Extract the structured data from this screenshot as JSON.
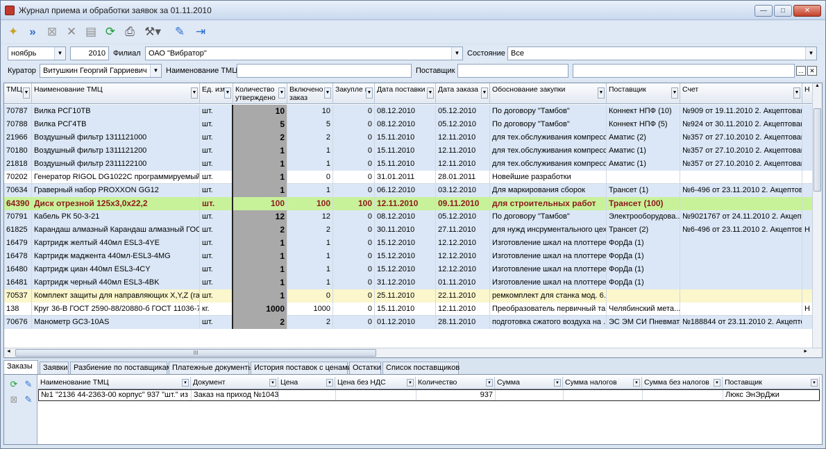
{
  "window": {
    "title": "Журнал приема и обработки заявок за 01.11.2010",
    "buttons": [
      "—",
      "□",
      "✕"
    ]
  },
  "toolbar": {
    "icons": [
      "wand-icon",
      "forward-icon",
      "cancel-box-icon",
      "delete-icon",
      "save-icon",
      "refresh-icon",
      "print-icon",
      "tools-icon",
      "edit-icon",
      "exit-icon"
    ]
  },
  "filters": {
    "month": "ноябрь",
    "year": "2010",
    "branch_label": "Филиал",
    "branch": "ОАО \"Вибратор\"",
    "state_label": "Состояние",
    "state": "Все",
    "curator_label": "Куратор",
    "curator": "Витушкин Георгий Гарриевич",
    "tmc_label": "Наименование ТМЦ",
    "tmc": "",
    "supplier_label": "Поставщик",
    "supplier": "",
    "extra": "",
    "ellipsis": "...",
    "clear": "✕"
  },
  "grid": {
    "headers": [
      "ТМЦ",
      "Наименование ТМЦ",
      "Ед. изм.",
      "Количество утверждено",
      "Включено в заказ",
      "Закупле но",
      "Дата поставки",
      "Дата заказа",
      "Обоснование закупки",
      "Поставщик",
      "Счет",
      "Н"
    ],
    "rows": [
      {
        "style": "blue",
        "c": [
          "70787",
          "Вилка РСГ10ТВ",
          "шт.",
          "10",
          "10",
          "0",
          "08.12.2010",
          "05.12.2010",
          "По договору \"Тамбов\"",
          "Коннект НПФ (10)",
          "№909 от 19.11.2010 2. Акцептован",
          ""
        ]
      },
      {
        "style": "blue",
        "c": [
          "70788",
          "Вилка РСГ4ТВ",
          "шт.",
          "5",
          "5",
          "0",
          "08.12.2010",
          "05.12.2010",
          "По договору \"Тамбов\"",
          "Коннект НПФ (5)",
          "№924 от 30.11.2010 2. Акцептован",
          ""
        ]
      },
      {
        "style": "blue",
        "c": [
          "21966",
          "Воздушный фильтр 1311121000",
          "шт.",
          "2",
          "2",
          "0",
          "15.11.2010",
          "12.11.2010",
          "для тех.обслуживания компресс...",
          "Аматис (2)",
          "№357 от 27.10.2010 2. Акцептован",
          ""
        ]
      },
      {
        "style": "blue",
        "c": [
          "70180",
          "Воздушный фильтр 1311121200",
          "шт.",
          "1",
          "1",
          "0",
          "15.11.2010",
          "12.11.2010",
          "для тех.обслуживания компресс...",
          "Аматис (1)",
          "№357 от 27.10.2010 2. Акцептован",
          ""
        ]
      },
      {
        "style": "blue",
        "c": [
          "21818",
          "Воздушный фильтр 2311122100",
          "шт.",
          "1",
          "1",
          "0",
          "15.11.2010",
          "12.11.2010",
          "для тех.обслуживания компресс...",
          "Аматис (1)",
          "№357 от 27.10.2010 2. Акцептован",
          ""
        ]
      },
      {
        "style": "white",
        "c": [
          "70202",
          "Генератор RIGOL DG1022C программируемый",
          "шт.",
          "1",
          "0",
          "0",
          "31.01.2011",
          "28.01.2011",
          "Новейшие разработки",
          "",
          "",
          ""
        ]
      },
      {
        "style": "blue",
        "c": [
          "70634",
          "Граверный набор PROXXON GG12",
          "шт.",
          "1",
          "1",
          "0",
          "06.12.2010",
          "03.12.2010",
          "Для маркирования сборок",
          "Трансет (1)",
          "№6-496 от 23.11.2010 2. Акцептован",
          ""
        ]
      },
      {
        "style": "hl",
        "c": [
          "64390",
          "Диск отрезной 125х3,0х22,2",
          "шт.",
          "100",
          "100",
          "100",
          "12.11.2010",
          "09.11.2010",
          "для строительных работ",
          "Трансет (100)",
          "",
          ""
        ]
      },
      {
        "style": "blue",
        "c": [
          "70791",
          "Кабель РК 50-3-21",
          "шт.",
          "12",
          "12",
          "0",
          "08.12.2010",
          "05.12.2010",
          "По договору \"Тамбов\"",
          "Электрооборудова...",
          "№9021767 от 24.11.2010 2. Акцепт...",
          ""
        ]
      },
      {
        "style": "blue",
        "c": [
          "61825",
          "Карандаш алмазный Карандаш алмазный ГОС...",
          "шт.",
          "2",
          "2",
          "0",
          "30.11.2010",
          "27.11.2010",
          "для нужд инсрументального цеха",
          "Трансет (2)",
          "№6-496 от 23.11.2010 2. Акцептован",
          "Н"
        ]
      },
      {
        "style": "blue",
        "c": [
          "16479",
          "Картридж желтый 440мл ESL3-4YE",
          "шт.",
          "1",
          "1",
          "0",
          "15.12.2010",
          "12.12.2010",
          "Изготовление шкал на плоттере...",
          "ФорДа (1)",
          "",
          ""
        ]
      },
      {
        "style": "blue",
        "c": [
          "16478",
          "Картридж маджента 440мл-ESL3-4MG",
          "шт.",
          "1",
          "1",
          "0",
          "15.12.2010",
          "12.12.2010",
          "Изготовление шкал на плоттере...",
          "ФорДа (1)",
          "",
          ""
        ]
      },
      {
        "style": "blue",
        "c": [
          "16480",
          "Картридж циан 440мл ESL3-4CY",
          "шт.",
          "1",
          "1",
          "0",
          "15.12.2010",
          "12.12.2010",
          "Изготовление шкал на плоттере...",
          "ФорДа (1)",
          "",
          ""
        ]
      },
      {
        "style": "blue",
        "c": [
          "16481",
          "Картридж черный 440мл ESL3-4BK",
          "шт.",
          "1",
          "1",
          "0",
          "31.12.2010",
          "01.11.2010",
          "Изготовление шкал на плоттере...",
          "ФорДа (1)",
          "",
          ""
        ]
      },
      {
        "style": "yel",
        "c": [
          "70537",
          "Комплект защиты для направляющих X,Y,Z (га...",
          "шт.",
          "1",
          "0",
          "0",
          "25.11.2010",
          "22.11.2010",
          "ремкомплект для станка мод. 6...",
          "",
          "",
          ""
        ]
      },
      {
        "style": "white",
        "c": [
          "138",
          "Круг 36-В ГОСТ 2590-88/20880-б ГОСТ 11036-75",
          "кг.",
          "1000",
          "1000",
          "0",
          "15.11.2010",
          "12.11.2010",
          "Преобразователь первичный та...",
          "Челябинский мета...",
          "",
          "Н"
        ]
      },
      {
        "style": "blue",
        "c": [
          "70676",
          "Манометр GC3-10AS",
          "шт.",
          "2",
          "2",
          "0",
          "01.12.2010",
          "28.11.2010",
          "подготовка сжатого воздуха на ...",
          "ЭС ЭМ СИ Пневмат...",
          "№188844 от 23.11.2010 2. Акцепто...",
          ""
        ]
      }
    ],
    "hscroll_grip": "III"
  },
  "tabs": [
    "Заказы",
    "Заявки",
    "Разбиение по поставщикам",
    "Платежные документы",
    "История поставок с ценами",
    "Остатки",
    "Список поставщиков"
  ],
  "subgrid": {
    "headers": [
      "Наименование ТМЦ",
      "Документ",
      "Цена",
      "Цена без НДС",
      "Количество",
      "Сумма",
      "Сумма налогов",
      "Сумма без налогов",
      "Поставщик"
    ],
    "row": [
      "№1 \"2136 44-2363-00 корпус\" 937 \"шт.\" из ...",
      "Заказ на приход №1043...",
      "",
      "",
      "937",
      "",
      "",
      "",
      "Люкс ЭнЭрДжи"
    ]
  }
}
